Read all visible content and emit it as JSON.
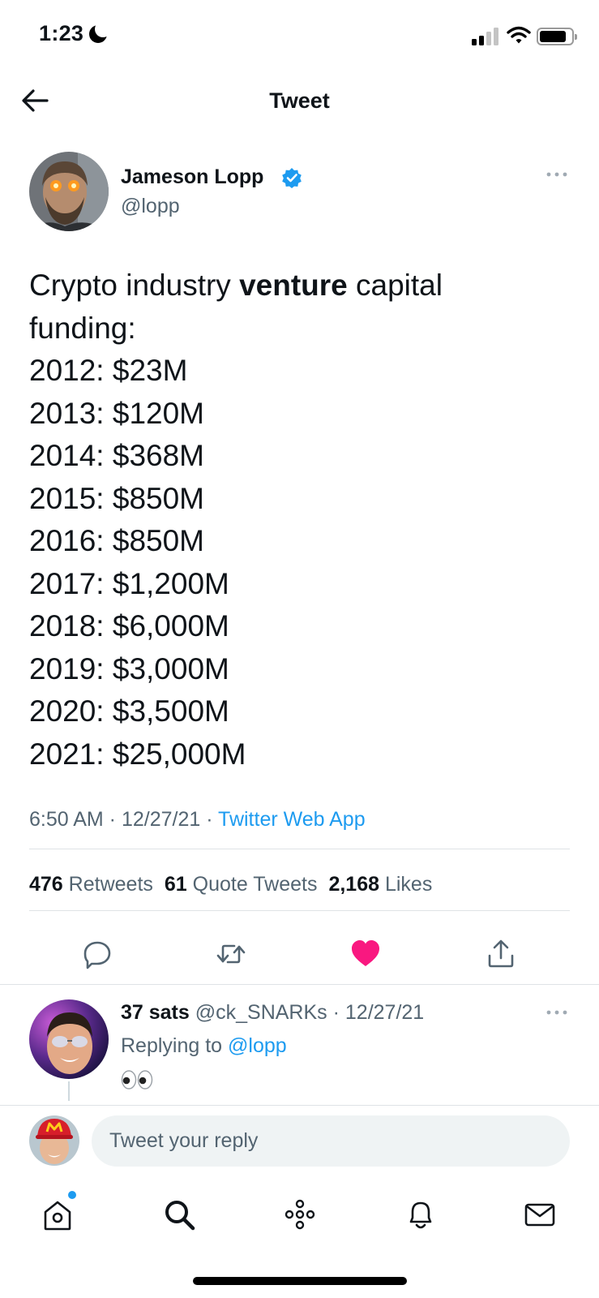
{
  "status_bar": {
    "time": "1:23"
  },
  "header": {
    "title": "Tweet"
  },
  "tweet": {
    "author_name": "Jameson Lopp",
    "author_handle": "@lopp",
    "text_line1_a": "Crypto industry ",
    "text_line1_bold": "venture",
    "text_line1_b": " capital",
    "text_line2": "funding:",
    "funding": [
      "2012: $23M",
      "2013: $120M",
      "2014: $368M",
      "2015: $850M",
      "2016: $850M",
      "2017: $1,200M",
      "2018: $6,000M",
      "2019: $3,000M",
      "2020: $3,500M",
      "2021: $25,000M"
    ],
    "time": "6:50 AM",
    "date": "12/27/21",
    "source": "Twitter Web App",
    "separator": " · "
  },
  "stats": {
    "retweets_count": "476",
    "retweets_label": "Retweets",
    "quotes_count": "61",
    "quotes_label": "Quote Tweets",
    "likes_count": "2,168",
    "likes_label": "Likes"
  },
  "reply": {
    "name": "37 sats",
    "handle": "@ck_SNARKs",
    "date": "12/27/21",
    "replying_prefix": "Replying to",
    "replying_to": "@lopp",
    "content_emoji": "eyes"
  },
  "compose": {
    "placeholder": "Tweet your reply"
  },
  "colors": {
    "accent": "#1d9bf0",
    "like": "#f91880",
    "secondary_text": "#536471"
  }
}
